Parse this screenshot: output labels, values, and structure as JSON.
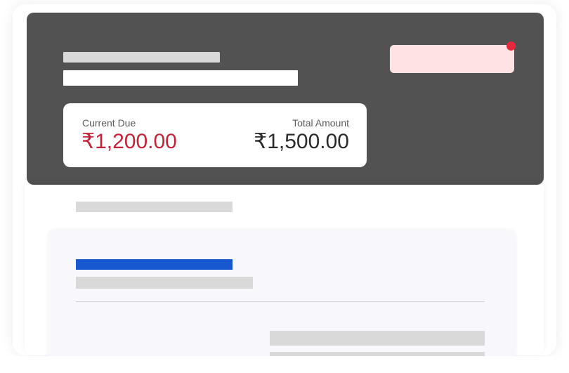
{
  "balance_card": {
    "current_due_label": "Current Due",
    "current_due_value": "₹1,200.00",
    "total_amount_label": "Total Amount",
    "total_amount_value": "₹1,500.00"
  },
  "colors": {
    "header_bg": "#525252",
    "accent_red": "#c4243a",
    "notification_dot": "#e8283c",
    "badge_bg": "#ffe3e4",
    "accent_blue": "#1758d1",
    "skeleton": "#d9d9d9"
  }
}
